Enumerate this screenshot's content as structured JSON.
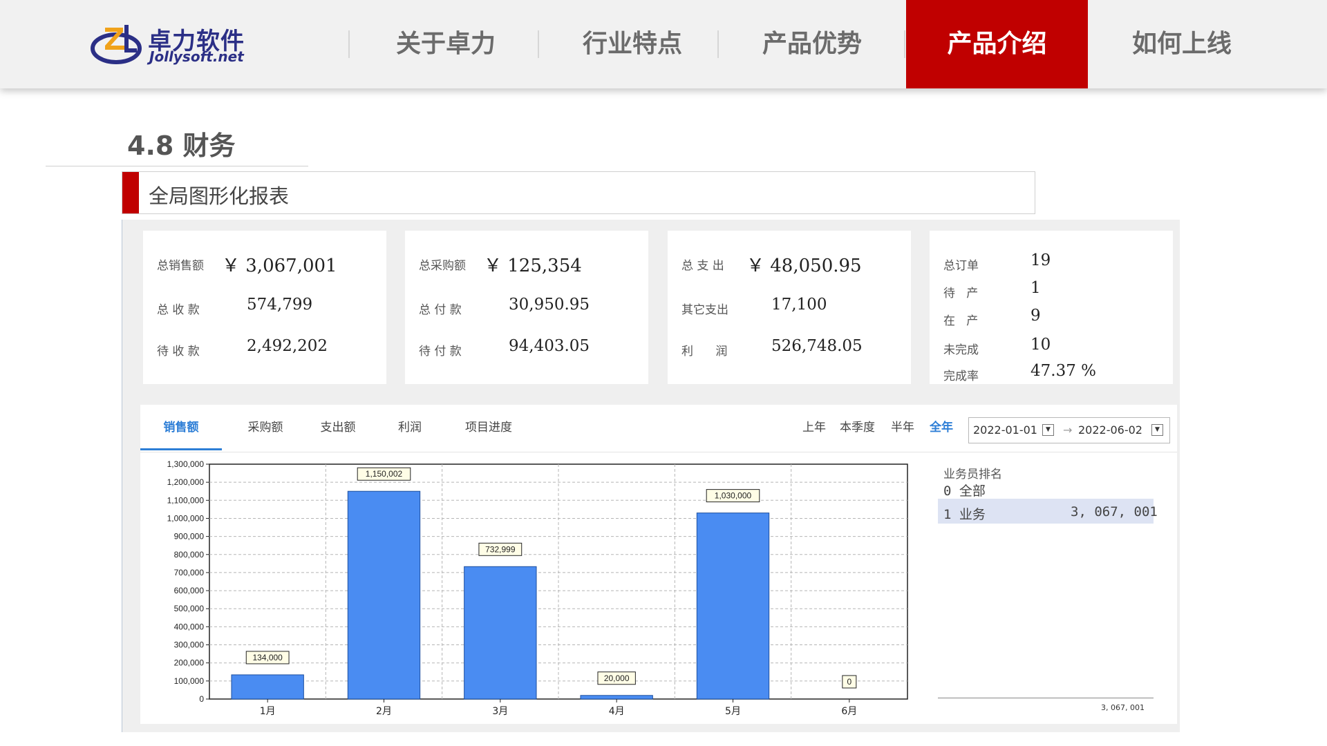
{
  "brand": {
    "name_cn": "卓力软件",
    "name_en": "Jollysoft.net"
  },
  "nav": {
    "items": [
      {
        "label": "关于卓力"
      },
      {
        "label": "行业特点"
      },
      {
        "label": "产品优势"
      },
      {
        "label": "产品介绍",
        "active": true
      },
      {
        "label": "如何上线"
      }
    ]
  },
  "section": {
    "title": "4.8 财务",
    "subtitle": "全局图形化报表"
  },
  "summary": {
    "sales": {
      "total_label": "总销售额",
      "total_value": "￥ 3,067,001",
      "received_label": "总 收 款",
      "received_value": "574,799",
      "pending_label": "待 收 款",
      "pending_value": "2,492,202"
    },
    "purchase": {
      "total_label": "总采购额",
      "total_value": "￥ 125,354",
      "paid_label": "总 付 款",
      "paid_value": "30,950.95",
      "pending_label": "待 付 款",
      "pending_value": "94,403.05"
    },
    "expense": {
      "total_label": "总 支 出",
      "total_value": "￥ 48,050.95",
      "other_label": "其它支出",
      "other_value": "17,100",
      "profit_label": "利      润",
      "profit_value": "526,748.05"
    },
    "orders": {
      "total_label": "总订单",
      "total_value": "19",
      "waiting_label": "待   产",
      "waiting_value": "1",
      "inprod_label": "在   产",
      "inprod_value": "9",
      "unfinished_label": "未完成",
      "unfinished_value": "10",
      "rate_label": "完成率",
      "rate_value": "47.37 %"
    }
  },
  "tabs": [
    {
      "label": "销售额",
      "active": true
    },
    {
      "label": "采购额"
    },
    {
      "label": "支出额"
    },
    {
      "label": "利润"
    },
    {
      "label": "项目进度"
    }
  ],
  "ranges": [
    {
      "label": "上年"
    },
    {
      "label": "本季度"
    },
    {
      "label": "半年"
    },
    {
      "label": "全年",
      "active": true
    }
  ],
  "date_range": {
    "start": "2022-01-01",
    "end": "2022-06-02",
    "arrow": "→"
  },
  "ranking": {
    "title": "业务员排名",
    "items": [
      {
        "label": "0 全部",
        "value": ""
      },
      {
        "label": "1 业务",
        "value": "3, 067, 001",
        "selected": true
      }
    ],
    "axis_label": "3, 067, 001"
  },
  "chart_data": {
    "type": "bar",
    "categories": [
      "1月",
      "2月",
      "3月",
      "4月",
      "5月",
      "6月"
    ],
    "values": [
      134000,
      1150002,
      732999,
      20000,
      1030000,
      0
    ],
    "data_labels": [
      "134,000",
      "1,150,002",
      "732,999",
      "20,000",
      "1,030,000",
      "0"
    ],
    "ylim": [
      0,
      1300000
    ],
    "ytick_step": 100000,
    "grid": true,
    "bar_color": "#4a8cf2"
  },
  "colors": {
    "accent_red": "#c00000",
    "tab_blue": "#2d7ed6",
    "brand_navy": "#2b2f86"
  }
}
